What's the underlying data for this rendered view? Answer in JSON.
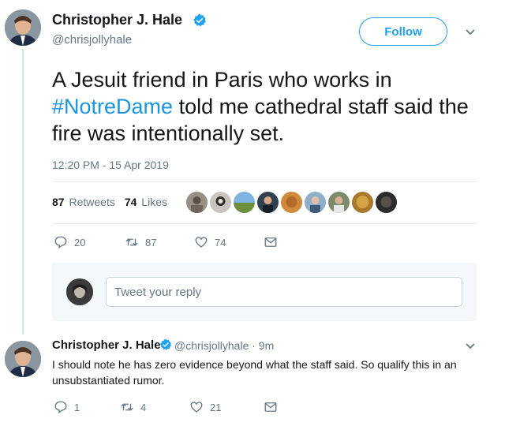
{
  "main_tweet": {
    "author_name": "Christopher J. Hale",
    "author_handle": "@chrisjollyhale",
    "follow_label": "Follow",
    "text_before": "A Jesuit friend in Paris who works in ",
    "hashtag": "#NotreDame",
    "text_after": " told me cathedral staff said the fire was intentionally set.",
    "timestamp": "12:20 PM - 15 Apr 2019",
    "retweets_count": "87",
    "retweets_label": "Retweets",
    "likes_count": "74",
    "likes_label": "Likes",
    "actions": {
      "replies": "20",
      "retweets": "87",
      "likes": "74"
    }
  },
  "reply_composer": {
    "placeholder": "Tweet your reply"
  },
  "reply_tweet": {
    "author_name": "Christopher J. Hale",
    "author_handle": "@chrisjollyhale",
    "time": "· 9m",
    "text": "I should note he has zero evidence beyond what the staff said. So qualify this in an unsubstantiated rumor.",
    "actions": {
      "replies": "1",
      "retweets": "4",
      "likes": "21"
    }
  },
  "colors": {
    "accent": "#1da1f2",
    "link": "#1b95e0",
    "muted": "#657786",
    "thread_line": "#cde2f4"
  }
}
